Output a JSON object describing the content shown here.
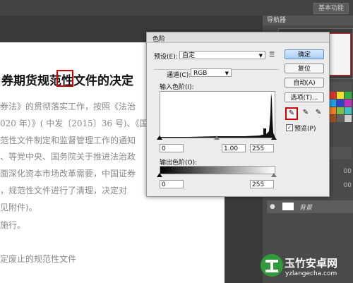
{
  "topbar": {
    "workspace_label": "基本功能"
  },
  "document": {
    "title": "券期货规范性文件的决定",
    "lines": [
      "券法》的贯彻落实工作，按照《法治",
      "020 年）》( 中发〔2015〕36 号)、《国",
      "范性文件制定和监督管理工作的通知",
      "、等党中央、国务院关于推进法治政",
      "面深化资本市场改革需要，中国证券",
      "，规范性文件进行了清理，决定对",
      "见附件)。",
      "施行。",
      "定废止的规范性文件"
    ]
  },
  "navigator": {
    "tab_label": "导航器"
  },
  "layers": {
    "layer_name": "背景"
  },
  "side_numbers": [
    "00",
    "00"
  ],
  "dialog": {
    "title": "色阶",
    "preset_label": "预设(E):",
    "preset_value": "自定",
    "channel_label": "通道(C):",
    "channel_value": "RGB",
    "input_levels_label": "输入色阶(I):",
    "input_black": "0",
    "input_gamma": "1.00",
    "input_white": "255",
    "output_levels_label": "输出色阶(O):",
    "output_black": "0",
    "output_white": "255",
    "buttons": {
      "ok": "确定",
      "reset": "复位",
      "auto": "自动(A)",
      "options": "选项(T)..."
    },
    "preview_label": "预览(P)",
    "preview_checked": true
  },
  "watermark": {
    "title": "玉竹安卓网",
    "url": "yzlangecha.com"
  },
  "colors": {
    "accent_red": "#d00000",
    "dialog_bg": "#ececec",
    "primary_button": "#a9cdf5"
  }
}
